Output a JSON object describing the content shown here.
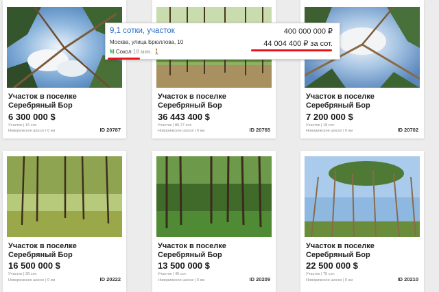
{
  "listings": [
    {
      "title": "Участок в поселке Серебряный Бор",
      "price": "6 300 000 $",
      "area": "Участок | 15 сот.",
      "road": "Новорижское шоссе | 0 км",
      "id": "ID 20787"
    },
    {
      "title": "Участок в поселке Серебряный Бор",
      "price": "36 443 400 $",
      "area": "Участок | 86,77 сот.",
      "road": "Новорижское шоссе | 0 км",
      "id": "ID 20765"
    },
    {
      "title": "Участок в поселке Серебряный Бор",
      "price": "7 200 000 $",
      "area": "Участок | 18 сот.",
      "road": "Новорижское шоссе | 0 км",
      "id": "ID 20702"
    },
    {
      "title": "Участок в поселке Серебряный Бор",
      "price": "16 500 000 $",
      "area": "Участок | 39 сот.",
      "road": "Новорижское шоссе | 0 км",
      "id": "ID 20222"
    },
    {
      "title": "Участок в поселке Серебряный Бор",
      "price": "13 500 000 $",
      "area": "Участок | 45 сот.",
      "road": "Новорижское шоссе | 0 км",
      "id": "ID 20209"
    },
    {
      "title": "Участок в поселке Серебряный Бор",
      "price": "22 500 000 $",
      "area": "Участок | 75 сот.",
      "road": "Новорижское шоссе | 0 км",
      "id": "ID 20210"
    }
  ],
  "popup": {
    "title": "9,1 сотки, участок",
    "price": "400 000 000 ₽",
    "address": "Москва, улица Брюллова, 10",
    "price_per_sotka": "44 004 400 ₽ за сот.",
    "metro_icon": "М",
    "metro_station": "Сокол",
    "metro_time": "18 мин.",
    "walk_icon": "🚶"
  },
  "colors": {
    "link": "#2b6fc8",
    "highlight_underline": "#e8141b",
    "metro": "#2aa84a"
  }
}
